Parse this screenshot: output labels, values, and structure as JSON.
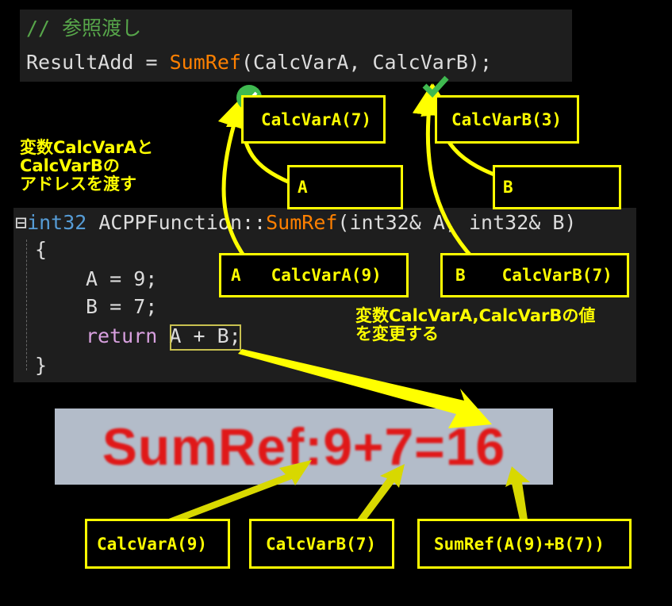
{
  "top_code": {
    "comment": "// 参照渡し",
    "line2_var": "ResultAdd",
    "line2_eq": " = ",
    "line2_func": "SumRef",
    "line2_args": "(CalcVarA, CalcVarB);"
  },
  "func_code": {
    "collapse": "⊟",
    "type": "int32",
    "class": " ACPPFunction::",
    "name": "SumRef",
    "params": "(int32& A, int32& B)",
    "brace_open": "{",
    "line_a": "A = 9;",
    "line_b": "B = 7;",
    "return_kw": "return",
    "return_expr": "A + B",
    "semicolon": ";",
    "brace_close": "}"
  },
  "labels": {
    "calcvara_7": "CalcVarA(7)",
    "calcvarb_3": "CalcVarB(3)",
    "a_ref": "A",
    "b_ref": "B",
    "a_calcvara_9_a": "A",
    "a_calcvara_9_b": "CalcVarA(9)",
    "b_calcvarb_7_a": "B",
    "b_calcvarb_7_b": "CalcVarB(7)",
    "bottom_a": "CalcVarA(9)",
    "bottom_b": "CalcVarB(7)",
    "bottom_sum": "SumRef(A(9)+B(7))"
  },
  "notes": {
    "pass_address_1": "変数CalcVarAと",
    "pass_address_2": "CalcVarBの",
    "pass_address_3": "アドレスを渡す",
    "change_value_1": "変数CalcVarA,CalcVarBの値",
    "change_value_2": "を変更する"
  },
  "result": {
    "text": "SumRef:9+7=16"
  },
  "colors": {
    "accent": "#ffff00",
    "check": "#3fb950",
    "result_text": "#e01818"
  }
}
